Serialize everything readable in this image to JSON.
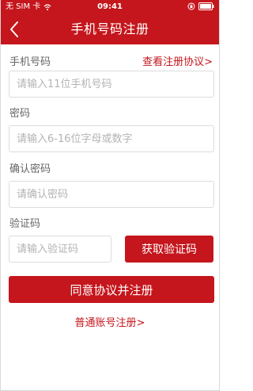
{
  "status_bar": {
    "carrier": "无 SIM 卡",
    "time": "09:41"
  },
  "nav": {
    "title": "手机号码注册"
  },
  "form": {
    "phone_label": "手机号码",
    "agreement_link": "查看注册协议>",
    "phone_placeholder": "请输入11位手机号码",
    "password_label": "密码",
    "password_placeholder": "请输入6-16位字母或数字",
    "confirm_label": "确认密码",
    "confirm_placeholder": "请确认密码",
    "code_label": "验证码",
    "code_placeholder": "请输入验证码",
    "get_code_button": "获取验证码",
    "submit_button": "同意协议并注册",
    "normal_register_link": "普通账号注册>"
  },
  "colors": {
    "brand_red": "#c4161c",
    "placeholder_gray": "#b3b3b3",
    "label_gray": "#666666"
  },
  "icons": {
    "back": "chevron-left-icon",
    "wifi": "wifi-icon",
    "lock": "orientation-lock-icon",
    "battery": "battery-icon"
  }
}
